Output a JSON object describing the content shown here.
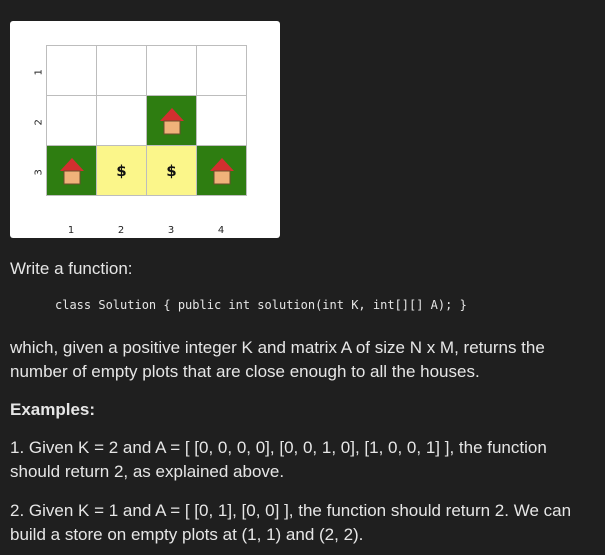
{
  "figure": {
    "row_labels": [
      "1",
      "2",
      "3"
    ],
    "col_labels": [
      "1",
      "2",
      "3",
      "4"
    ],
    "grid": [
      [
        "empty",
        "empty",
        "empty",
        "empty"
      ],
      [
        "empty",
        "empty",
        "house",
        "empty"
      ],
      [
        "house",
        "store",
        "store",
        "house"
      ]
    ],
    "store_symbol": "$",
    "colors": {
      "house_cell": "#2e7d11",
      "store_cell": "#fbf68a",
      "roof": "#d32f2f",
      "wall": "#f0b27a"
    },
    "icons": [
      "house-icon",
      "dollar-sign"
    ]
  },
  "intro": "Write a function:",
  "code": "class Solution { public int solution(int K, int[][] A); }",
  "description": "which, given a positive integer K and matrix A of size N x M, returns the number of empty plots that are close enough to all the houses.",
  "examples_heading": "Examples:",
  "example1": "1. Given K = 2 and A = [ [0, 0, 0, 0], [0, 0, 1, 0], [1, 0, 0, 1] ], the function should return 2, as explained above.",
  "example2": "2. Given K = 1 and A = [ [0, 1], [0, 0] ], the function should return 2. We can build a store on empty plots at (1, 1) and (2, 2)."
}
